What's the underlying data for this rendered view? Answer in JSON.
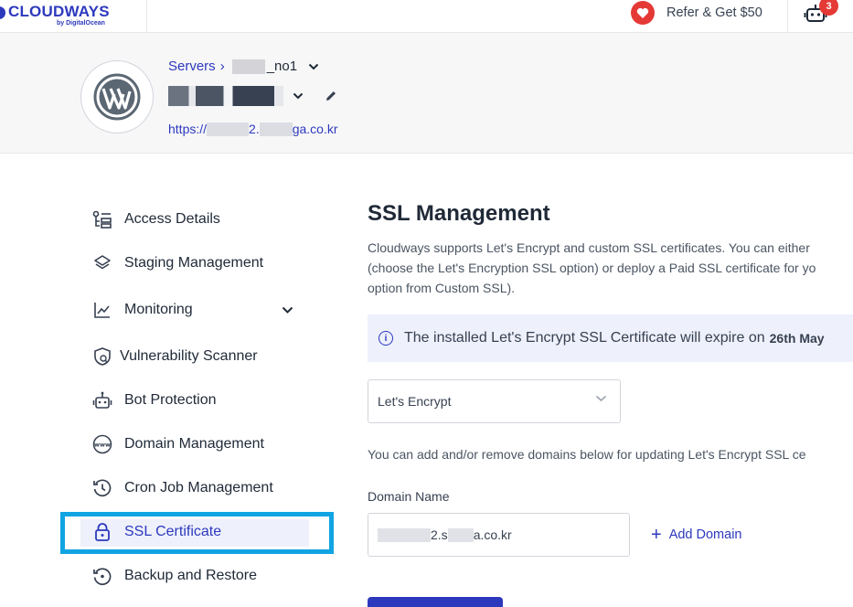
{
  "topbar": {
    "logo_text": "CLOUDWAYS",
    "logo_sub": "by DigitalOcean",
    "refer_label": "Refer & Get $50",
    "notification_count": "3",
    "brand_color": "#2c39bd",
    "badge_color": "#e53935"
  },
  "header": {
    "breadcrumb_label": "Servers",
    "breadcrumb_separator": "›",
    "server_name_suffix": "_no1",
    "app_url_prefix": "https://",
    "app_url_mid": "2.",
    "app_url_suffix": "ga.co.kr",
    "app_icon": "wordpress-icon"
  },
  "sidebar": {
    "items": [
      {
        "label": "Access Details",
        "icon": "access-details-icon"
      },
      {
        "label": "Staging Management",
        "icon": "layers-icon"
      },
      {
        "label": "Monitoring",
        "icon": "chart-line-icon"
      },
      {
        "label": "Vulnerability Scanner",
        "icon": "shield-bug-icon"
      },
      {
        "label": "Bot Protection",
        "icon": "robot-icon"
      },
      {
        "label": "Domain Management",
        "icon": "www-globe-icon"
      },
      {
        "label": "Cron Job Management",
        "icon": "history-clock-icon"
      },
      {
        "label": "SSL Certificate",
        "icon": "lock-icon"
      },
      {
        "label": "Backup and Restore",
        "icon": "restore-icon"
      }
    ],
    "active_item": "SSL Certificate",
    "highlight_color": "#10a4e3"
  },
  "main": {
    "title": "SSL Management",
    "desc_line1": "Cloudways supports Let's Encrypt and custom SSL certificates. You can either",
    "desc_line2": "(choose the Let's Encryption SSL option) or deploy a Paid SSL certificate for yo",
    "desc_line3": "option from Custom SSL).",
    "info_text": "The installed Let's Encrypt SSL Certificate will expire on",
    "info_date": "26th May",
    "ssl_type_selected": "Let's Encrypt",
    "add_desc": "You can add and/or remove domains below for updating Let's Encrypt SSL ce",
    "domain_label": "Domain Name",
    "domain_value_mid": "2.s",
    "domain_value_suffix": "a.co.kr",
    "add_domain_label": "Add Domain",
    "add_domain_plus": "+"
  }
}
